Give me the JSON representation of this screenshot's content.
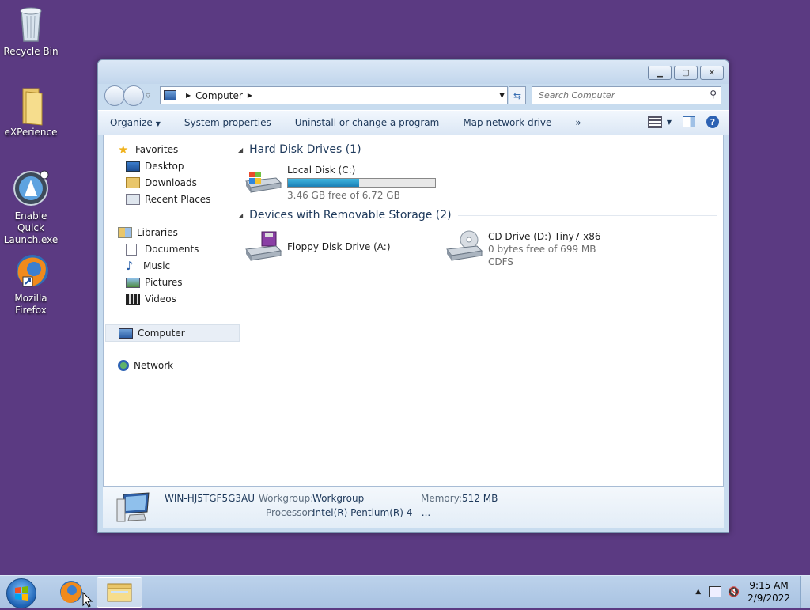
{
  "desktop": {
    "icons": [
      {
        "label_line1": "Recycle Bin",
        "label_line2": "",
        "icon": "recycle-bin-icon"
      },
      {
        "label_line1": "eXPerience",
        "label_line2": "",
        "icon": "folder-icon"
      },
      {
        "label_line1": "Enable Quick",
        "label_line2": "Launch.exe",
        "icon": "quick-launch-icon"
      },
      {
        "label_line1": "Mozilla",
        "label_line2": "Firefox",
        "icon": "firefox-icon"
      }
    ]
  },
  "window": {
    "address": {
      "location": "Computer"
    },
    "search": {
      "placeholder": "Search Computer"
    },
    "toolbar": {
      "organize": "Organize",
      "system_properties": "System properties",
      "uninstall": "Uninstall or change a program",
      "map_drive": "Map network drive",
      "more": "»"
    },
    "nav": {
      "favorites": "Favorites",
      "desktop": "Desktop",
      "downloads": "Downloads",
      "recent_places": "Recent Places",
      "libraries": "Libraries",
      "documents": "Documents",
      "music": "Music",
      "pictures": "Pictures",
      "videos": "Videos",
      "computer": "Computer",
      "network": "Network"
    },
    "groups": {
      "hard_disk": "Hard Disk Drives (1)",
      "removable": "Devices with Removable Storage (2)"
    },
    "drives": {
      "c": {
        "name": "Local Disk (C:)",
        "free": "3.46 GB free of 6.72 GB",
        "used_fraction": 0.485
      },
      "a": {
        "name": "Floppy Disk Drive (A:)"
      },
      "d": {
        "name": "CD Drive (D:) Tiny7 x86",
        "free": "0 bytes free of 699 MB",
        "fs": "CDFS"
      }
    },
    "details": {
      "computer_name": "WIN-HJ5TGF5G3AU",
      "workgroup_label": "Workgroup:",
      "workgroup_value": "Workgroup",
      "memory_label": "Memory:",
      "memory_value": "512 MB",
      "processor_label": "Processor:",
      "processor_value": "Intel(R) Pentium(R) 4   ..."
    }
  },
  "taskbar": {
    "time": "9:15 AM",
    "date": "2/9/2022"
  }
}
